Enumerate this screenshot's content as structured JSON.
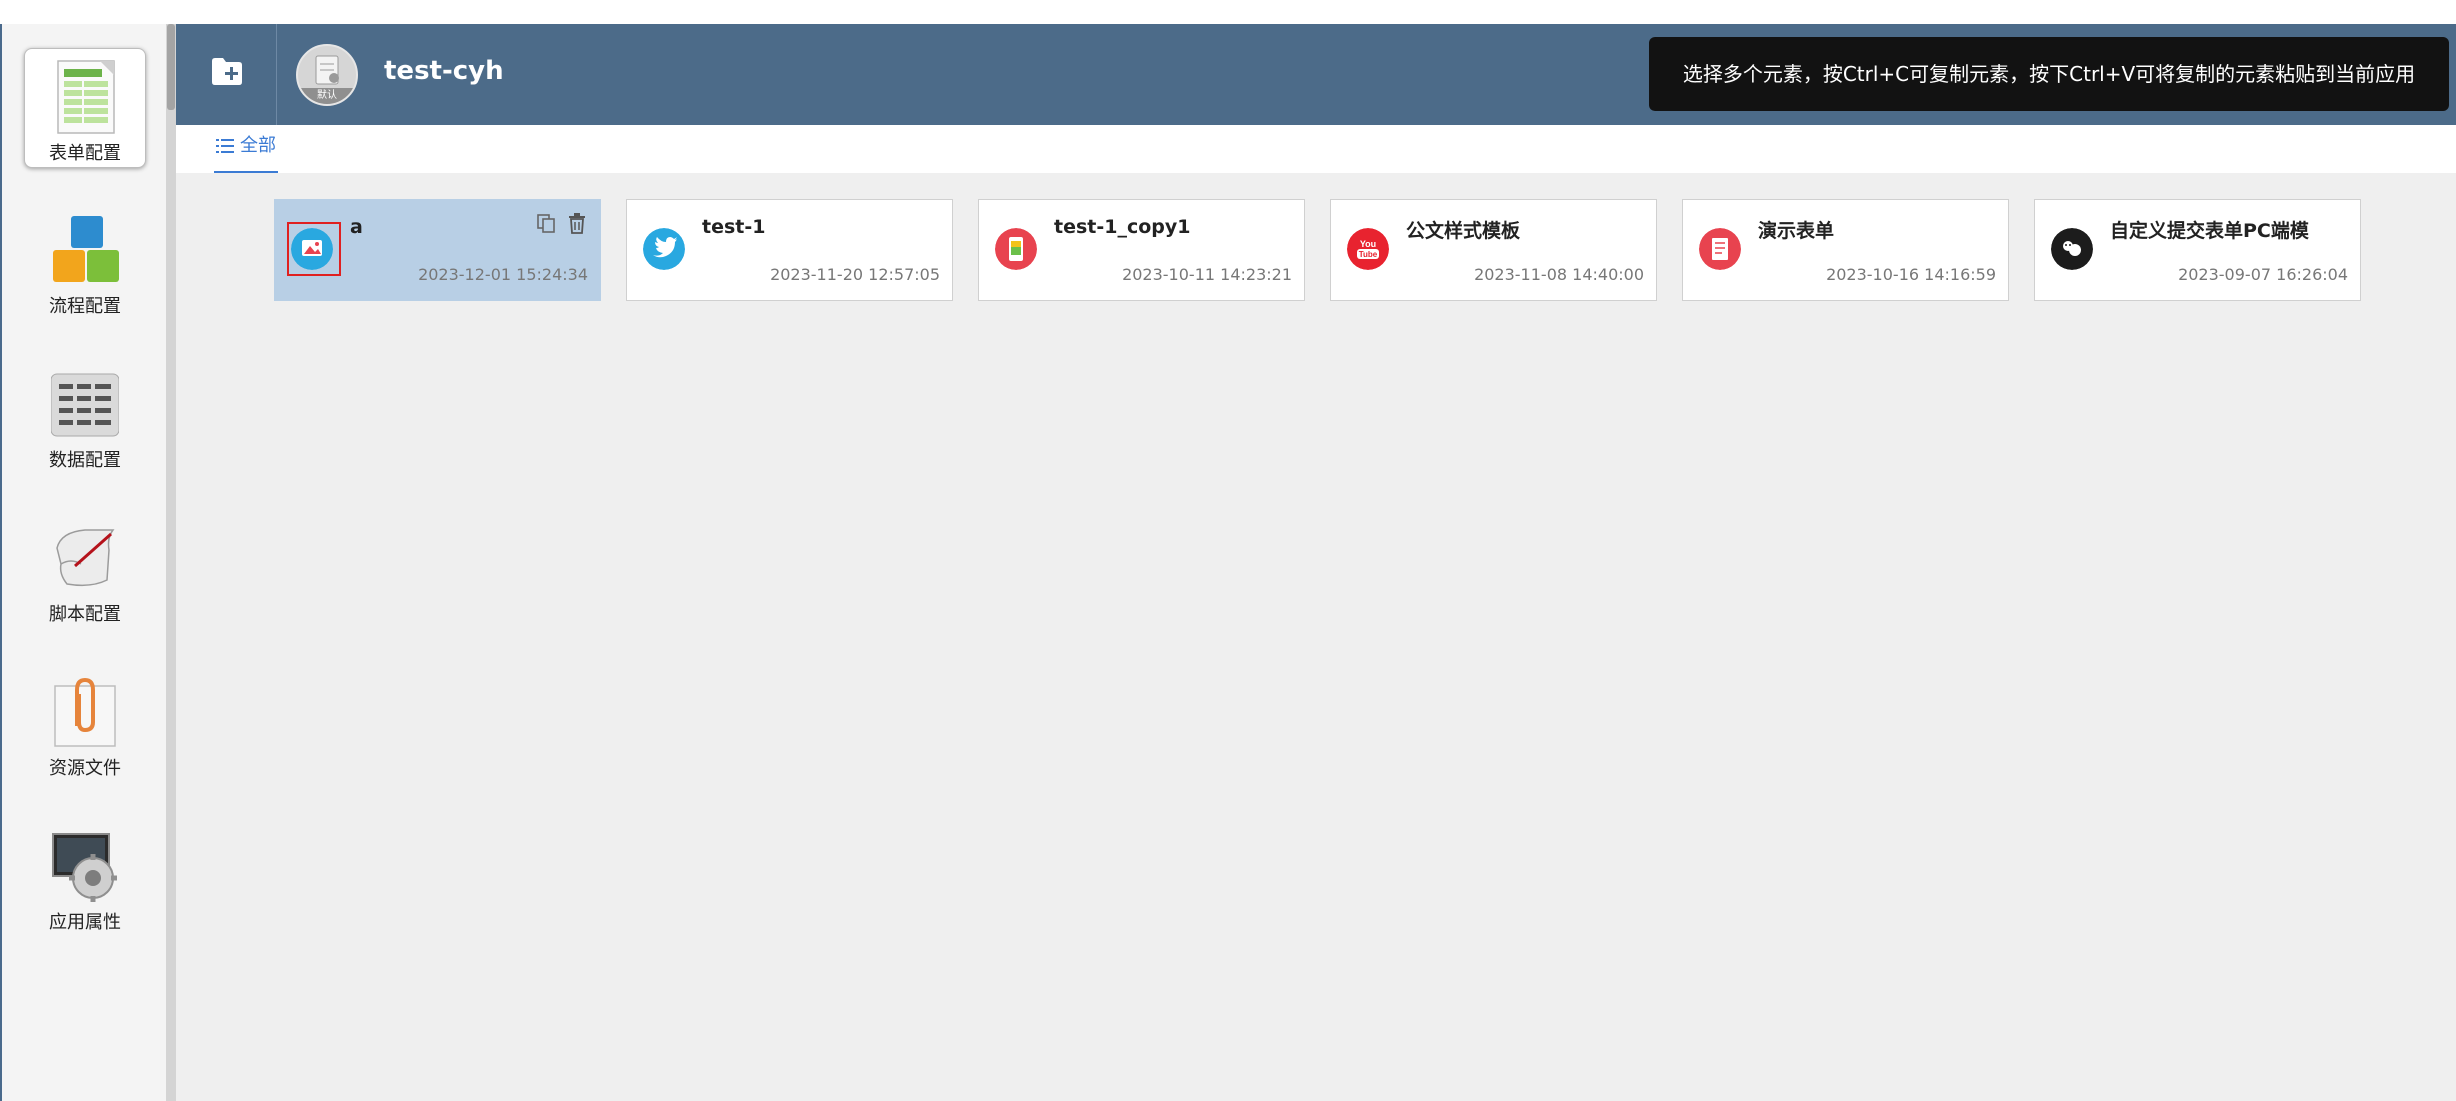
{
  "sidebar": {
    "items": [
      {
        "label": "表单配置",
        "icon": "form-config-icon",
        "active": true
      },
      {
        "label": "流程配置",
        "icon": "process-config-icon"
      },
      {
        "label": "数据配置",
        "icon": "data-config-icon"
      },
      {
        "label": "脚本配置",
        "icon": "script-config-icon"
      },
      {
        "label": "资源文件",
        "icon": "resource-file-icon"
      },
      {
        "label": "应用属性",
        "icon": "app-properties-icon"
      }
    ]
  },
  "header": {
    "app_name": "test-cyh",
    "app_badge": "默认",
    "toast": "选择多个元素，按Ctrl+C可复制元素，按下Ctrl+V可将复制的元素粘贴到当前应用"
  },
  "tabs": {
    "all_label": "全部"
  },
  "cards": [
    {
      "title": "a",
      "time": "2023-12-01 15:24:34",
      "icon": "image-icon",
      "color": "#29a8e0",
      "selected": true
    },
    {
      "title": "test-1",
      "time": "2023-11-20 12:57:05",
      "icon": "twitter-icon",
      "color": "#29a8e0"
    },
    {
      "title": "test-1_copy1",
      "time": "2023-10-11 14:23:21",
      "icon": "mobile-photo-icon",
      "color": "#e8434f"
    },
    {
      "title": "公文样式模板",
      "time": "2023-11-08 14:40:00",
      "icon": "youtube-icon",
      "color": "#e8232f"
    },
    {
      "title": "演示表单",
      "time": "2023-10-16 14:16:59",
      "icon": "document-icon",
      "color": "#e8434f"
    },
    {
      "title": "自定义提交表单PC端模",
      "time": "2023-09-07 16:26:04",
      "icon": "chat-icon",
      "color": "#1c1c1c"
    }
  ],
  "colors": {
    "header": "#4c6b89",
    "accent": "#3b7bd4",
    "selected_card": "#b8cfe5"
  }
}
